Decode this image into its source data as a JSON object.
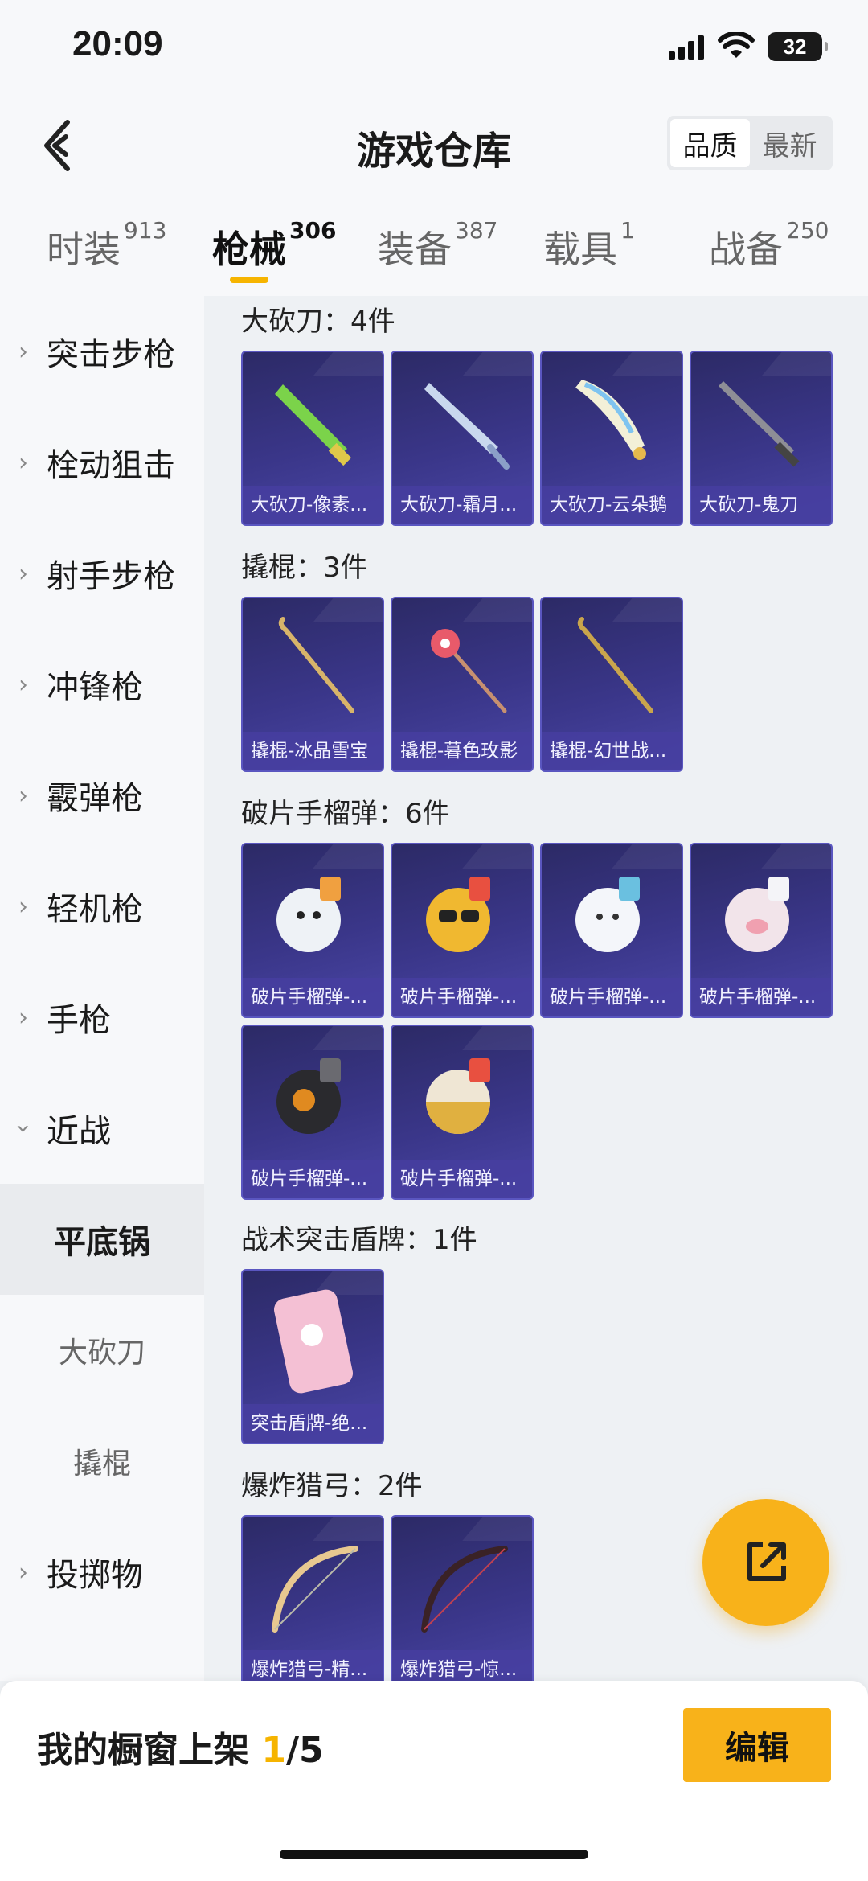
{
  "status": {
    "time": "20:09",
    "battery": "32"
  },
  "header": {
    "title": "游戏仓库",
    "back_icon": "chevron-left-icon",
    "sort": {
      "quality": "品质",
      "newest": "最新",
      "selected": "品质"
    }
  },
  "tabs": [
    {
      "label": "时装",
      "count": "913"
    },
    {
      "label": "枪械",
      "count": "306"
    },
    {
      "label": "装备",
      "count": "387"
    },
    {
      "label": "载具",
      "count": "1"
    },
    {
      "label": "战备",
      "count": "250"
    }
  ],
  "active_tab": "枪械",
  "sidebar": [
    {
      "label": "突击步枪"
    },
    {
      "label": "栓动狙击"
    },
    {
      "label": "射手步枪"
    },
    {
      "label": "冲锋枪"
    },
    {
      "label": "霰弹枪"
    },
    {
      "label": "轻机枪"
    },
    {
      "label": "手枪"
    },
    {
      "label": "近战"
    },
    {
      "label": "平底锅"
    },
    {
      "label": "大砍刀"
    },
    {
      "label": "撬棍"
    },
    {
      "label": "投掷物"
    }
  ],
  "sections": [
    {
      "title": "大砍刀：4件",
      "items": [
        "大砍刀-像素...",
        "大砍刀-霜月...",
        "大砍刀-云朵鹅",
        "大砍刀-鬼刀"
      ]
    },
    {
      "title": "撬棍：3件",
      "items": [
        "撬棍-冰晶雪宝",
        "撬棍-暮色玫影",
        "撬棍-幻世战..."
      ]
    },
    {
      "title": "破片手榴弹：6件",
      "items": [
        "破片手榴弹-...",
        "破片手榴弹-...",
        "破片手榴弹-...",
        "破片手榴弹-...",
        "破片手榴弹-...",
        "破片手榴弹-..."
      ]
    },
    {
      "title": "战术突击盾牌：1件",
      "items": [
        "突击盾牌-绝..."
      ]
    },
    {
      "title": "爆炸猎弓：2件",
      "items": [
        "爆炸猎弓-精...",
        "爆炸猎弓-惊..."
      ]
    }
  ],
  "fab_icon": "share-external-icon",
  "bottom": {
    "label": "我的橱窗上架",
    "current": "1",
    "total": "/5",
    "edit": "编辑"
  },
  "colors": {
    "accent": "#f8b21a",
    "card": "#3a3689"
  }
}
